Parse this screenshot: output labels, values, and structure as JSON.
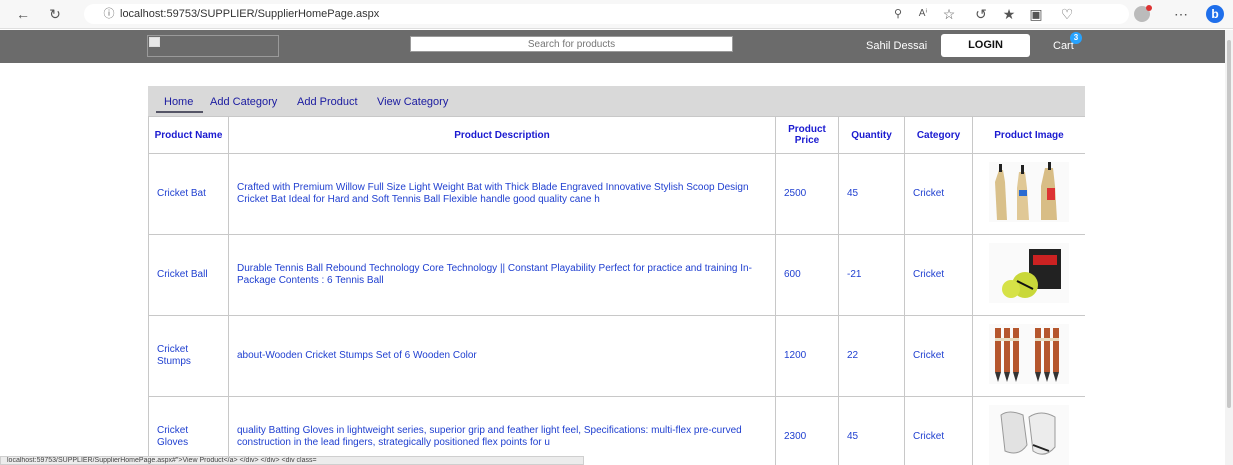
{
  "browser": {
    "url": "localhost:59753/SUPPLIER/SupplierHomePage.aspx",
    "bing_label": "b"
  },
  "header": {
    "search_placeholder": "Search for products",
    "username": "Sahil Dessai",
    "login_label": "LOGIN",
    "cart_label": "Cart",
    "cart_count": "3"
  },
  "tabs": [
    {
      "label": "Home"
    },
    {
      "label": "Add Category"
    },
    {
      "label": "Add Product"
    },
    {
      "label": "View Category"
    }
  ],
  "table": {
    "headers": [
      "Product Name",
      "Product Description",
      "Product Price",
      "Quantity",
      "Category",
      "Product Image"
    ],
    "rows": [
      {
        "name": "Cricket Bat",
        "description": "Crafted with Premium Willow Full Size Light Weight Bat with Thick Blade Engraved Innovative Stylish Scoop Design Cricket Bat Ideal for Hard and Soft Tennis Ball Flexible handle good quality cane h",
        "price": "2500",
        "quantity": "45",
        "category": "Cricket",
        "image": "cricket-bat-image"
      },
      {
        "name": "Cricket Ball",
        "description": "Durable Tennis Ball Rebound Technology Core Technology || Constant Playability Perfect for practice and training In-Package Contents : 6 Tennis Ball",
        "price": "600",
        "quantity": "-21",
        "category": "Cricket",
        "image": "cricket-ball-image"
      },
      {
        "name": "Cricket Stumps",
        "description": "about-Wooden Cricket Stumps Set of 6 Wooden Color",
        "price": "1200",
        "quantity": "22",
        "category": "Cricket",
        "image": "cricket-stumps-image"
      },
      {
        "name": "Cricket Gloves",
        "description": "quality Batting Gloves in lightweight series, superior grip and feather light feel, Specifications: multi-flex pre-curved construction in the lead fingers, strategically positioned flex points for u",
        "price": "2300",
        "quantity": "45",
        "category": "Cricket",
        "image": "cricket-gloves-image"
      }
    ]
  },
  "status_bar": {
    "text": "localhost:59753/SUPPLIER/SupplierHomePage.aspx#\">View Product</a> </div>               </div>          <div class="
  }
}
